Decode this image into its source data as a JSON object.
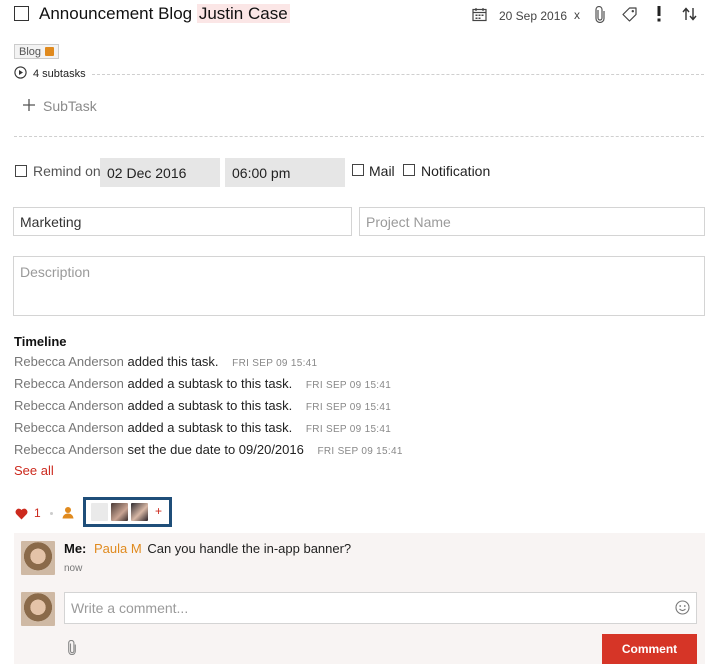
{
  "task": {
    "title": "Announcement Blog",
    "assignee": "Justin Case",
    "due_date": "20 Sep 2016",
    "clear_date": "x",
    "tag": "Blog",
    "subtasks_label": "4 subtasks",
    "add_subtask_label": "SubTask"
  },
  "reminder": {
    "label": "Remind on",
    "date": "02 Dec 2016",
    "time": "06:00 pm",
    "mail_label": "Mail",
    "notification_label": "Notification"
  },
  "fields": {
    "category": "Marketing",
    "project_placeholder": "Project Name",
    "description_placeholder": "Description"
  },
  "timeline": {
    "heading": "Timeline",
    "entries": [
      {
        "user": "Rebecca Anderson",
        "action": "added this task.",
        "time": "FRI SEP 09 15:41"
      },
      {
        "user": "Rebecca Anderson",
        "action": "added a subtask to this task.",
        "time": "FRI SEP 09 15:41"
      },
      {
        "user": "Rebecca Anderson",
        "action": "added a subtask to this task.",
        "time": "FRI SEP 09 15:41"
      },
      {
        "user": "Rebecca Anderson",
        "action": "added a subtask to this task.",
        "time": "FRI SEP 09 15:41"
      },
      {
        "user": "Rebecca Anderson",
        "action": "set the due date to 09/20/2016",
        "time": "FRI SEP 09 15:41"
      }
    ],
    "see_all": "See all"
  },
  "social": {
    "like_count": "1",
    "add_follower": "+"
  },
  "comments": [
    {
      "author": "Me:",
      "mention": "Paula M",
      "text": "Can you handle the in-app banner?",
      "time": "now"
    }
  ],
  "composer": {
    "placeholder": "Write a comment...",
    "submit_label": "Comment"
  },
  "colors": {
    "accent_red": "#d63527",
    "accent_orange": "#e08a1e",
    "highlight": "#fbe6e6",
    "selection_border": "#1f4e79"
  },
  "icons": [
    "calendar-icon",
    "paperclip-icon",
    "tag-icon",
    "priority-icon",
    "sort-icon",
    "play-circle-icon",
    "plus-icon",
    "heart-icon",
    "person-icon",
    "smiley-icon"
  ]
}
